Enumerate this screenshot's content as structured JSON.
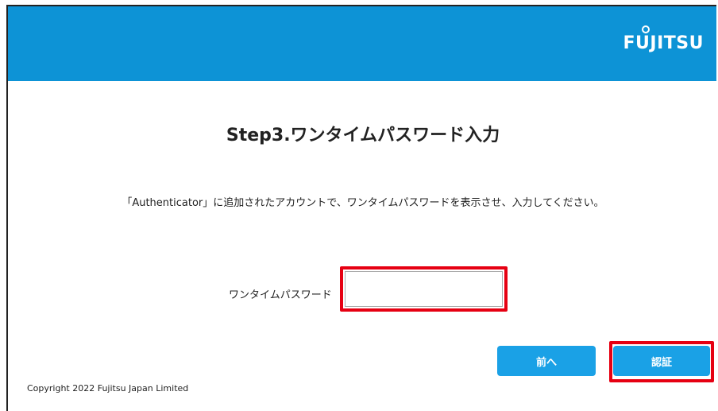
{
  "header": {
    "brand": "FUJITSU",
    "bg_color": "#0d93d6"
  },
  "main": {
    "title": "Step3.ワンタイムパスワード入力",
    "instruction": "「Authenticator」に追加されたアカウントで、ワンタイムパスワードを表示させ、入力してください。",
    "otp_label": "ワンタイムパスワード",
    "otp_value": "",
    "otp_placeholder": ""
  },
  "buttons": {
    "back_label": "前へ",
    "authenticate_label": "認証",
    "button_color": "#1aa1e6",
    "highlight_color": "#e60012"
  },
  "footer": {
    "copyright": "Copyright 2022 Fujitsu Japan Limited"
  }
}
